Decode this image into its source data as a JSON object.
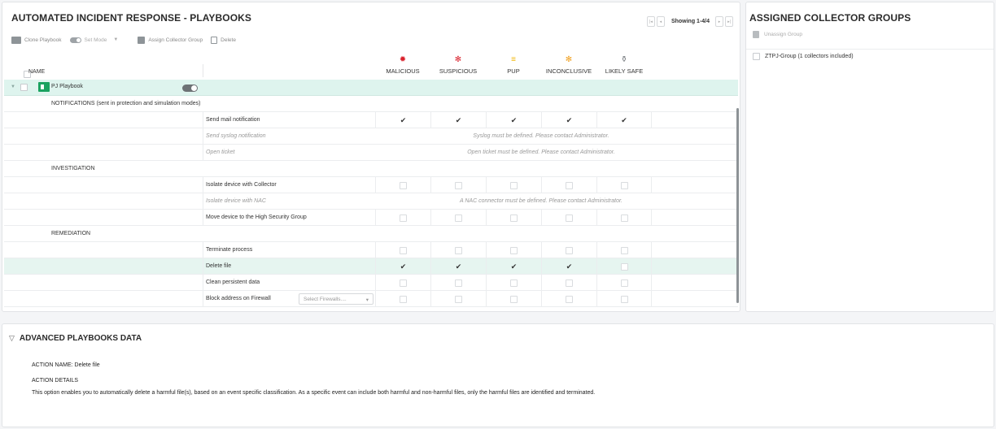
{
  "main": {
    "title": "AUTOMATED INCIDENT RESPONSE - PLAYBOOKS",
    "toolbar": {
      "clone": "Clone Playbook",
      "set_mode": "Set Mode",
      "assign": "Assign Collector Group",
      "delete": "Delete"
    },
    "pager": {
      "text": "Showing 1-4/4"
    },
    "name_header": "NAME",
    "verdicts": [
      {
        "label": "MALICIOUS",
        "icon": "bug-icon",
        "color": "#d9212c"
      },
      {
        "label": "SUSPICIOUS",
        "icon": "bug-icon",
        "color": "#d9212c"
      },
      {
        "label": "PUP",
        "icon": "pup-icon",
        "color": "#f0b400"
      },
      {
        "label": "INCONCLUSIVE",
        "icon": "bug-icon",
        "color": "#f0a020"
      },
      {
        "label": "LIKELY SAFE",
        "icon": "bug-icon",
        "color": "#7a7f83"
      }
    ],
    "playbook": {
      "name": "PJ Playbook"
    },
    "sections": {
      "notifications": "NOTIFICATIONS  (sent in protection and simulation modes)",
      "investigation": "INVESTIGATION",
      "remediation": "REMEDIATION"
    },
    "actions": {
      "send_mail": "Send mail notification",
      "send_syslog": "Send syslog notification",
      "syslog_msg": "Syslog must be defined. Please contact Administrator.",
      "open_ticket": "Open ticket",
      "ticket_msg": "Open ticket must be defined. Please contact Administrator.",
      "isolate_collector": "Isolate device with Collector",
      "isolate_nac": "Isolate device with NAC",
      "nac_msg": "A NAC connector must be defined. Please contact Administrator.",
      "move_high_sec": "Move device to the High Security Group",
      "terminate": "Terminate process",
      "delete_file": "Delete file",
      "clean_persistent": "Clean persistent data",
      "block_fw": "Block address on Firewall",
      "fw_placeholder": "Select Firewalls...."
    }
  },
  "groups": {
    "title": "ASSIGNED COLLECTOR GROUPS",
    "unassign": "Unassign Group",
    "items": [
      "ZTPJ-Group (1 collectors included)"
    ]
  },
  "advanced": {
    "title": "ADVANCED PLAYBOOKS DATA",
    "action_name_label": "ACTION NAME:",
    "action_name_value": "Delete file",
    "details_label": "ACTION DETAILS",
    "details_text": "This option enables you to automatically delete a harmful file(s), based on an event specific classification. As a specific event can include both harmful and non-harmful files, only the harmful files are identified and terminated."
  }
}
